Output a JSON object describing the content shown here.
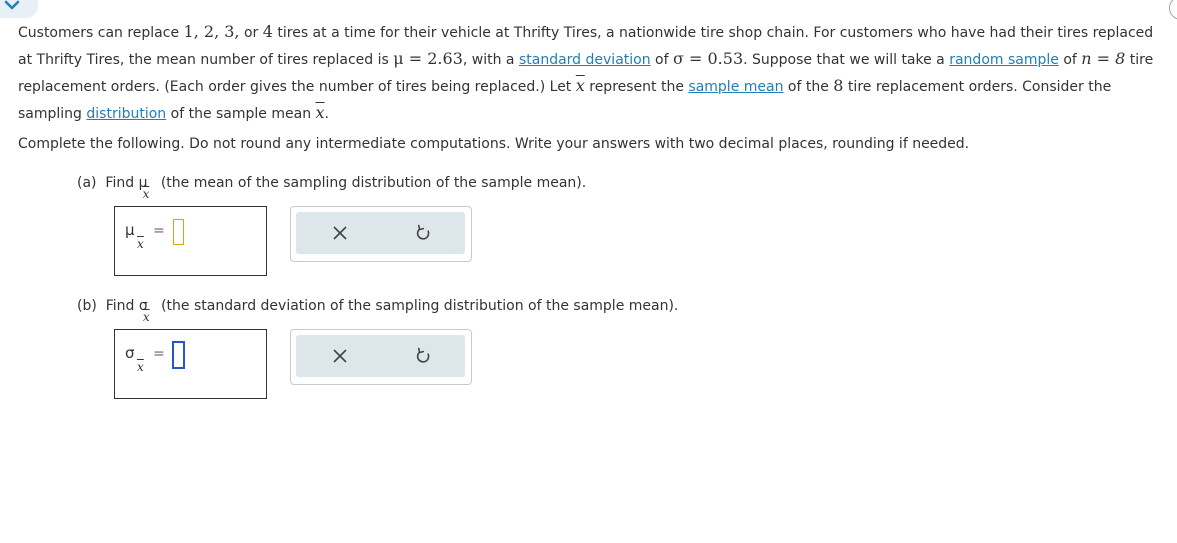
{
  "problem": {
    "p1_a": "Customers can replace ",
    "p1_nums": "1, 2, 3,",
    "p1_b": " or ",
    "p1_four": "4",
    "p1_c": " tires at a time for their vehicle at Thrifty Tires, a nationwide tire shop chain. For customers who have had their tires replaced",
    "p2_a": "at Thrifty Tires, the mean number of tires replaced is ",
    "mu_eq": "μ = 2.63",
    "p2_b": ", with a ",
    "link_std": "standard deviation",
    "p2_c": " of ",
    "sigma_eq": "σ = 0.53",
    "p2_d": ". Suppose that we will take a ",
    "link_random": "random sample",
    "p2_e": " of ",
    "n_eq": "n = 8",
    "p2_f": " tire",
    "p3_a": "replacement orders. (Each order gives the number of tires being replaced.) Let ",
    "xbar": "x",
    "p3_b": " represent the ",
    "link_sample_mean": "sample mean",
    "p3_c": " of the ",
    "eight": "8",
    "p3_d": " tire replacement orders. Consider the",
    "p4_a": "sampling ",
    "link_distribution": "distribution",
    "p4_b": " of the sample mean ",
    "p4_c": ".",
    "instructions": "Complete the following. Do not round any intermediate computations. Write your answers with two decimal places, rounding if needed."
  },
  "parts": [
    {
      "label": "(a)",
      "find": "Find",
      "symbol": "μ",
      "sub": "x",
      "desc": "(the mean of the sampling distribution of the sample mean).",
      "equals": "=",
      "value": ""
    },
    {
      "label": "(b)",
      "find": "Find",
      "symbol": "σ",
      "sub": "x",
      "desc": "(the standard deviation of the sampling distribution of the sample mean).",
      "equals": "=",
      "value": ""
    }
  ],
  "tools": {
    "clear_icon": "x-icon",
    "undo_icon": "undo-icon"
  },
  "colors": {
    "link": "#1f7fb6",
    "tool_bg": "#dde6ea",
    "input_border_a": "#d3a31f",
    "input_border_b": "#2a55c8"
  }
}
